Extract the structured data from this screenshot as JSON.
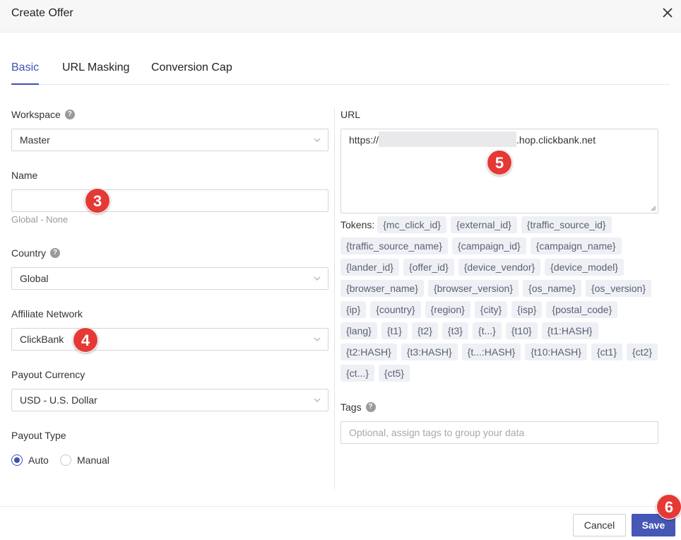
{
  "header": {
    "title": "Create Offer"
  },
  "tabs": [
    {
      "label": "Basic",
      "active": true
    },
    {
      "label": "URL Masking",
      "active": false
    },
    {
      "label": "Conversion Cap",
      "active": false
    }
  ],
  "form": {
    "workspace": {
      "label": "Workspace",
      "value": "Master"
    },
    "name": {
      "label": "Name",
      "value": "",
      "hint": "Global - None"
    },
    "country": {
      "label": "Country",
      "value": "Global"
    },
    "affiliate_network": {
      "label": "Affiliate Network",
      "value": "ClickBank"
    },
    "payout_currency": {
      "label": "Payout Currency",
      "value": "USD - U.S. Dollar"
    },
    "payout_type": {
      "label": "Payout Type",
      "options": [
        "Auto",
        "Manual"
      ],
      "selected": "Auto"
    },
    "url": {
      "label": "URL",
      "prefix": "https://",
      "suffix": ".hop.clickbank.net"
    },
    "tokens": {
      "label": "Tokens:",
      "items": [
        "{mc_click_id}",
        "{external_id}",
        "{traffic_source_id}",
        "{traffic_source_name}",
        "{campaign_id}",
        "{campaign_name}",
        "{lander_id}",
        "{offer_id}",
        "{device_vendor}",
        "{device_model}",
        "{browser_name}",
        "{browser_version}",
        "{os_name}",
        "{os_version}",
        "{ip}",
        "{country}",
        "{region}",
        "{city}",
        "{isp}",
        "{postal_code}",
        "{lang}",
        "{t1}",
        "{t2}",
        "{t3}",
        "{t...}",
        "{t10}",
        "{t1:HASH}",
        "{t2:HASH}",
        "{t3:HASH}",
        "{t...:HASH}",
        "{t10:HASH}",
        "{ct1}",
        "{ct2}",
        "{ct...}",
        "{ct5}"
      ]
    },
    "tags": {
      "label": "Tags",
      "placeholder": "Optional, assign tags to group your data"
    }
  },
  "footer": {
    "cancel_label": "Cancel",
    "save_label": "Save"
  },
  "annotations": [
    "3",
    "4",
    "5",
    "6"
  ],
  "colors": {
    "accent": "#3f51b5",
    "badge": "#e53935"
  }
}
